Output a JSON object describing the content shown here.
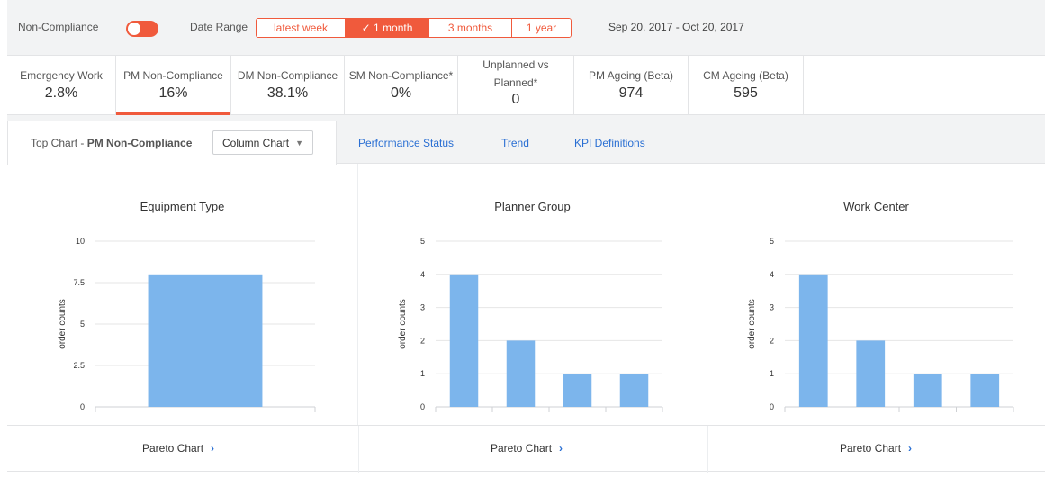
{
  "filters": {
    "non_compliance_label": "Non-Compliance",
    "non_compliance_on": true,
    "date_range_label": "Date Range",
    "ranges": [
      {
        "label": "latest week",
        "active": false
      },
      {
        "label": "✓ 1 month",
        "active": true
      },
      {
        "label": "3 months",
        "active": false
      },
      {
        "label": "1 year",
        "active": false
      }
    ],
    "date_text": "Sep 20, 2017 - Oct 20, 2017"
  },
  "kpis": [
    {
      "name": "Emergency Work",
      "value": "2.8%"
    },
    {
      "name": "PM Non-Compliance",
      "value": "16%",
      "active": true
    },
    {
      "name": "DM Non-Compliance",
      "value": "38.1%"
    },
    {
      "name": "SM Non-Compliance*",
      "value": "0%"
    },
    {
      "name_line1": "Unplanned vs",
      "name_line2": "Planned*",
      "value": "0"
    },
    {
      "name": "PM Ageing (Beta)",
      "value": "974"
    },
    {
      "name": "CM Ageing (Beta)",
      "value": "595"
    }
  ],
  "chart_header": {
    "top_chart_prefix": "Top Chart - ",
    "top_chart_name": "PM Non-Compliance",
    "chart_type_selected": "Column Chart",
    "tabs": [
      "Performance Status",
      "Trend",
      "KPI Definitions"
    ]
  },
  "colors": {
    "accent": "#f05a3c",
    "bar": "#7cb5ec",
    "link": "#2a6fd3"
  },
  "chart_data": [
    {
      "type": "bar",
      "title": "Equipment Type",
      "ylabel": "order counts",
      "ylim": [
        0,
        10
      ],
      "yticks": [
        "0",
        "2.5",
        "5",
        "7.5",
        "10"
      ],
      "categories": [
        ""
      ],
      "values": [
        8
      ]
    },
    {
      "type": "bar",
      "title": "Planner Group",
      "ylabel": "order counts",
      "ylim": [
        0,
        5
      ],
      "yticks": [
        "0",
        "1",
        "2",
        "3",
        "4",
        "5"
      ],
      "categories": [
        "",
        "",
        "",
        ""
      ],
      "values": [
        4,
        2,
        1,
        1
      ]
    },
    {
      "type": "bar",
      "title": "Work Center",
      "ylabel": "order counts",
      "ylim": [
        0,
        5
      ],
      "yticks": [
        "0",
        "1",
        "2",
        "3",
        "4",
        "5"
      ],
      "categories": [
        "",
        "",
        "",
        ""
      ],
      "values": [
        4,
        2,
        1,
        1
      ]
    }
  ],
  "footer": {
    "pareto_label": "Pareto Chart"
  }
}
